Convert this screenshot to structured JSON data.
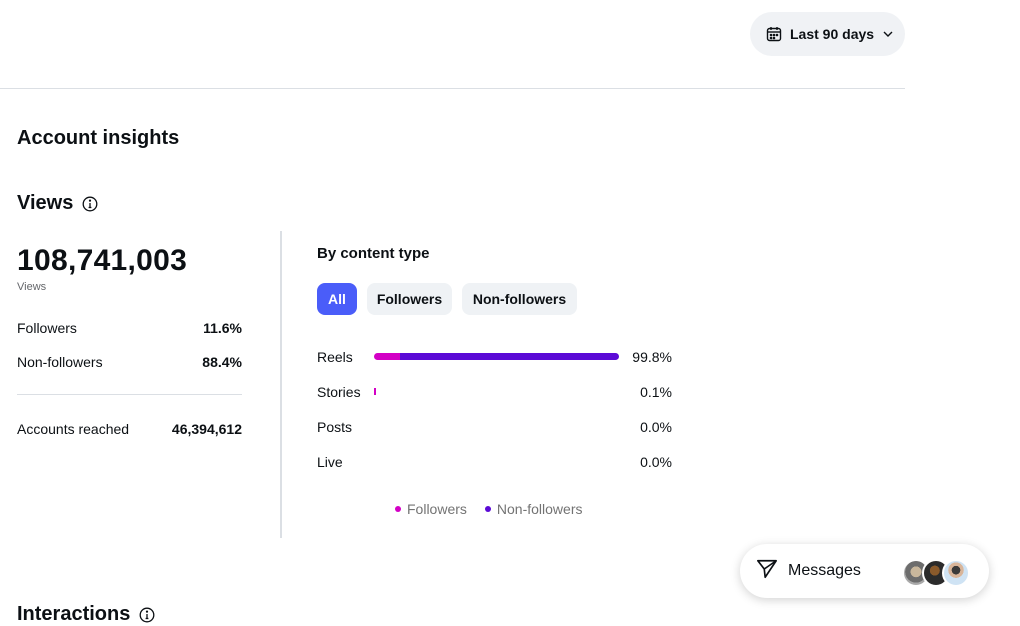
{
  "date_range": {
    "label": "Last 90 days",
    "icon": "calendar-icon"
  },
  "page_title": "Account insights",
  "views": {
    "title": "Views",
    "total": "108,741,003",
    "total_label": "Views",
    "stats": [
      {
        "label": "Followers",
        "value": "11.6%"
      },
      {
        "label": "Non-followers",
        "value": "88.4%"
      }
    ],
    "reached": {
      "label": "Accounts reached",
      "value": "46,394,612"
    }
  },
  "content_type": {
    "title": "By content type",
    "filters": [
      "All",
      "Followers",
      "Non-followers"
    ],
    "active_filter": "All",
    "rows": [
      {
        "label": "Reels",
        "pct": "99.8%",
        "followers_frac": 0.106,
        "nonfollowers_frac": 0.892
      },
      {
        "label": "Stories",
        "pct": "0.1%",
        "followers_frac": 0.004,
        "nonfollowers_frac": 0.0
      },
      {
        "label": "Posts",
        "pct": "0.0%",
        "followers_frac": 0.0,
        "nonfollowers_frac": 0.0
      },
      {
        "label": "Live",
        "pct": "0.0%",
        "followers_frac": 0.0,
        "nonfollowers_frac": 0.0
      }
    ],
    "legend": [
      {
        "label": "Followers",
        "color": "#d300c5"
      },
      {
        "label": "Non-followers",
        "color": "#5b0ad6"
      }
    ]
  },
  "interactions": {
    "title": "Interactions"
  },
  "messages": {
    "label": "Messages",
    "icon": "send-icon",
    "avatar_count": 3
  }
}
